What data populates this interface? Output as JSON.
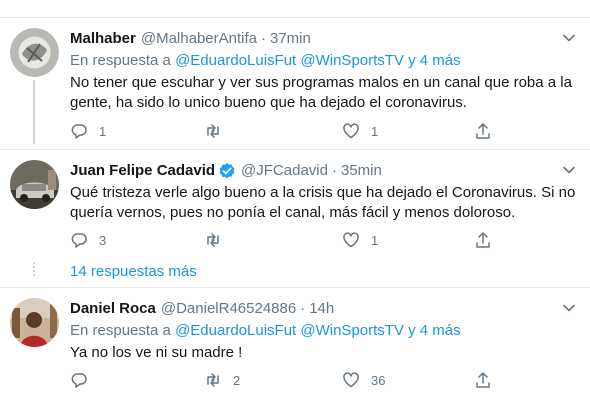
{
  "tweets": [
    {
      "name": "Malhaber",
      "handle": "@MalhaberAntifa",
      "time": "37min",
      "reply_prefix": "En respuesta a",
      "reply_mentions": "@EduardoLuisFut @WinSportsTV",
      "reply_suffix": "y 4 más",
      "text": "No tener que escuhar y ver sus programas malos en un canal que roba a la gente, ha sido lo unico bueno que ha dejado el coronavirus.",
      "replies": "1",
      "retweets": "",
      "likes": "1",
      "verified": false
    },
    {
      "name": "Juan Felipe Cadavid",
      "handle": "@JFCadavid",
      "time": "35min",
      "text": "Qué tristeza verle algo bueno a la crisis que ha dejado el Coronavirus. Si no quería vernos, pues no ponía el canal, más fácil y menos doloroso.",
      "replies": "3",
      "retweets": "",
      "likes": "1",
      "verified": true
    },
    {
      "name": "Daniel Roca",
      "handle": "@DanielR46524886",
      "time": "14h",
      "reply_prefix": "En respuesta a",
      "reply_mentions": "@EduardoLuisFut @WinSportsTV",
      "reply_suffix": "y 4 más",
      "text": "Ya no los ve ni su madre !",
      "replies": "",
      "retweets": "2",
      "likes": "36",
      "verified": false
    }
  ],
  "more_replies": "14 respuestas más",
  "dot_separator": "·",
  "colors": {
    "accent": "#1b95e0",
    "muted": "#657786",
    "border": "#e6ecf0"
  },
  "icons": [
    "reply-icon",
    "retweet-icon",
    "like-icon",
    "share-icon",
    "chevron-down-icon",
    "verified-badge-icon"
  ]
}
